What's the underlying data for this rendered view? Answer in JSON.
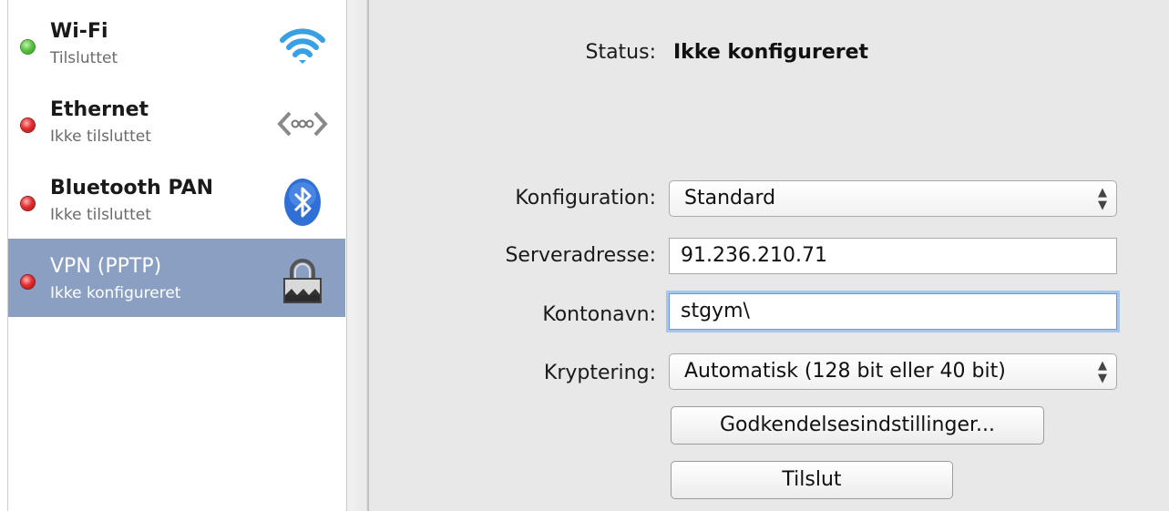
{
  "services": [
    {
      "name": "Wi-Fi",
      "status": "Tilsluttet",
      "dot": "green",
      "icon": "wifi-icon",
      "selected": false
    },
    {
      "name": "Ethernet",
      "status": "Ikke tilsluttet",
      "dot": "red",
      "icon": "ethernet-icon",
      "selected": false
    },
    {
      "name": "Bluetooth PAN",
      "status": "Ikke tilsluttet",
      "dot": "red",
      "icon": "bluetooth-icon",
      "selected": false
    },
    {
      "name": "VPN (PPTP)",
      "status": "Ikke konfigureret",
      "dot": "red",
      "icon": "lock-icon",
      "selected": true
    }
  ],
  "panel": {
    "status_label": "Status:",
    "status_value": "Ikke konfigureret",
    "configuration_label": "Konfiguration:",
    "configuration_value": "Standard",
    "server_label": "Serveradresse:",
    "server_value": "91.236.210.71",
    "account_label": "Kontonavn:",
    "account_value": "stgym\\",
    "encryption_label": "Kryptering:",
    "encryption_value": "Automatisk (128 bit eller 40 bit)",
    "auth_button": "Godkendelsesindstillinger...",
    "connect_button": "Tilslut"
  },
  "colors": {
    "selected_row": "#8b9fc3",
    "panel_bg": "#e8e8e8",
    "focus_ring": "#a7c6ee",
    "status_green": "#5cc543",
    "status_red": "#e53030"
  }
}
